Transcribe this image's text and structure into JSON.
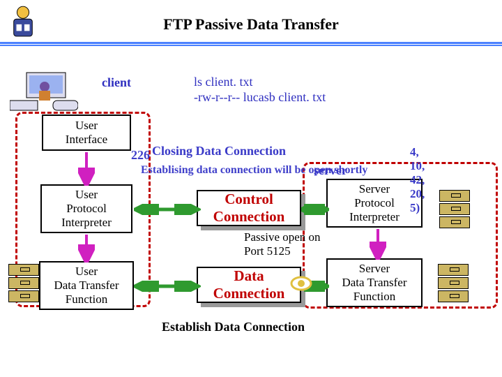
{
  "title": "FTP Passive Data Transfer",
  "client_label": "client",
  "terminal": {
    "line1": "ls client. txt",
    "line2": "-rw-r--r-- lucasb client. txt"
  },
  "blocks": {
    "ui": "User\nInterface",
    "upi": "User\nProtocol\nInterpreter",
    "udt": "User\nData Transfer\nFunction",
    "spi": "Server\nProtocol\nInterpreter",
    "sdt": "Server\nData Transfer\nFunction"
  },
  "connections": {
    "control": "Control\nConnection",
    "data": "Data\nConnection"
  },
  "passive_label": "Passive open on\nPort 5125",
  "establish_label": "Establish Data Connection",
  "status": {
    "prefix": "226",
    "overlay": "Closing Data Connection",
    "mangled": "Establising data connection will be open shortly",
    "port_tuple": "4, 10, 42, 20, 5)",
    "server_word": "server"
  },
  "icons": {
    "logo": "university-shield-logo",
    "workstation": "desktop-computer-person",
    "filecab": "file-cabinet"
  }
}
